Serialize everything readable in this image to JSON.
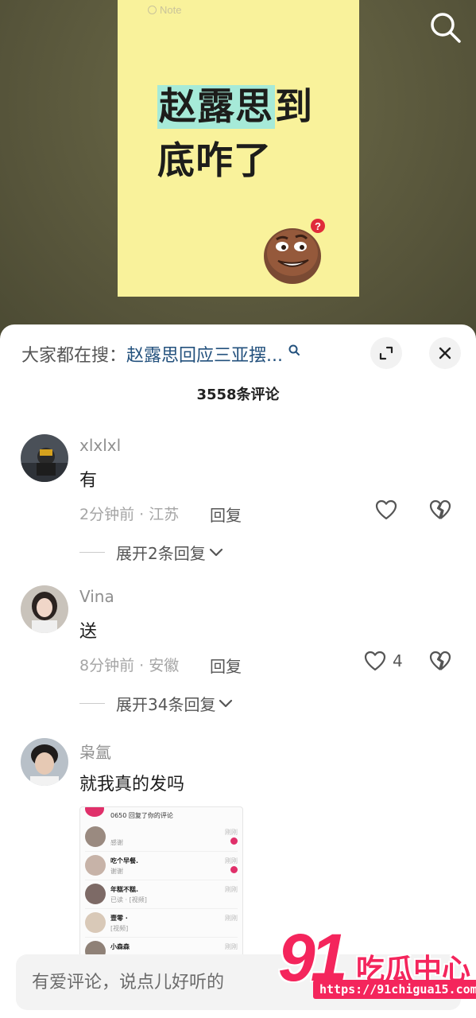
{
  "video": {
    "note_brand": "Note",
    "note_line1_highlight": "赵露思",
    "note_line1_rest": "到",
    "note_line2": "底咋了"
  },
  "header": {
    "trending_prefix": "大家都在搜：",
    "trending_query": "赵露思回应三亚摆...",
    "comment_count": "3558条评论"
  },
  "comments": [
    {
      "username": "xlxlxl",
      "text": "有",
      "time_location": "2分钟前 · 江苏",
      "reply_label": "回复",
      "likes": "",
      "expand_label": "展开2条回复"
    },
    {
      "username": "Vina",
      "text": "送",
      "time_location": "8分钟前 · 安徽",
      "reply_label": "回复",
      "likes": "4",
      "expand_label": "展开34条回复"
    },
    {
      "username": "枭氲",
      "text": "就我真的发吗",
      "attachment": {
        "header": "0650 回复了你的评论",
        "rows": [
          {
            "name": "",
            "sub": "感谢",
            "time": "刚刚"
          },
          {
            "name": "吃个早餐.",
            "sub": "谢谢",
            "time": "刚刚"
          },
          {
            "name": "年糕不糕.",
            "sub": "已读 · [视频]",
            "time": "刚刚"
          },
          {
            "name": "壹零 ·",
            "sub": "[视频]",
            "time": "刚刚"
          },
          {
            "name": "小森森",
            "sub": "",
            "time": "刚刚"
          }
        ]
      }
    }
  ],
  "input": {
    "placeholder": "有爱评论，说点儿好听的"
  },
  "watermark": {
    "number": "91",
    "name": "吃瓜中心",
    "url": "https://91chigua15.com"
  }
}
